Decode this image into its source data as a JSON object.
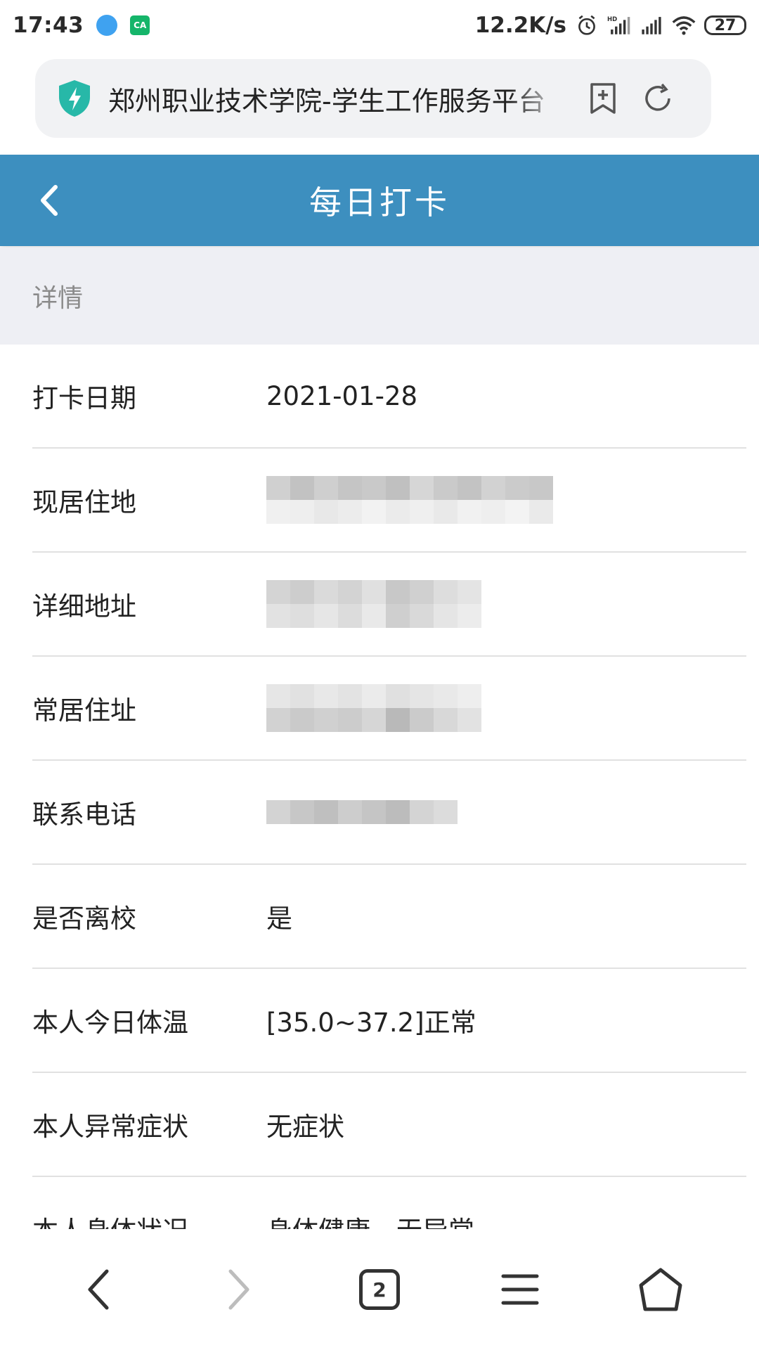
{
  "status_bar": {
    "time": "17:43",
    "net_speed": "12.2K/s",
    "battery": "27",
    "hd_label": "HD"
  },
  "address_bar": {
    "url_title": "郑州职业技术学院-学生工作服务平台"
  },
  "header": {
    "title": "每日打卡"
  },
  "section": {
    "heading": "详情"
  },
  "rows": [
    {
      "label": "打卡日期",
      "value": "2021-01-28"
    },
    {
      "label": "现居住地",
      "value": ""
    },
    {
      "label": "详细地址",
      "value": ""
    },
    {
      "label": "常居住址",
      "value": ""
    },
    {
      "label": "联系电话",
      "value": ""
    },
    {
      "label": "是否离校",
      "value": "是"
    },
    {
      "label": "本人今日体温",
      "value": "[35.0~37.2]正常"
    },
    {
      "label": "本人异常症状",
      "value": "无症状"
    },
    {
      "label": "本人身体状况",
      "value": "身体健康、无异常"
    }
  ],
  "bottom_nav": {
    "tabs_count": "2"
  },
  "colors": {
    "header_bg": "#3d8fbf",
    "section_bg": "#eeeff4",
    "shield": "#27b8a8"
  }
}
